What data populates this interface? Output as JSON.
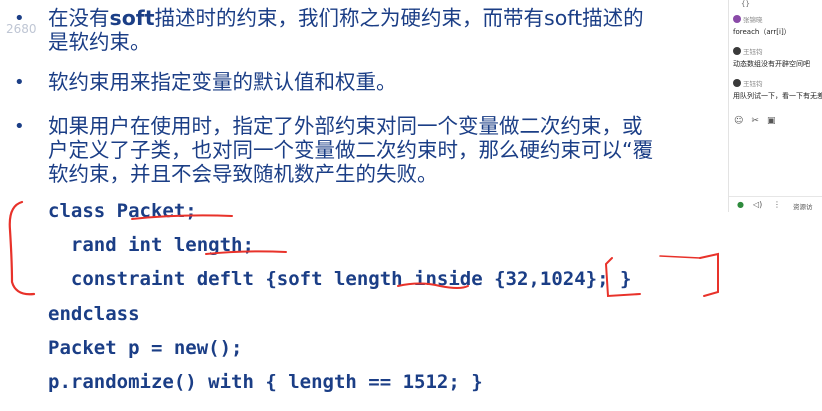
{
  "watermark": "2680",
  "bullets": [
    {
      "part1": "在没有",
      "bold": "soft",
      "part2": "描述时的约束，我们称之为硬约束，而带有soft描述的",
      "line2": "是软约束。"
    },
    {
      "line1": "软约束用来指定变量的默认值和权重。"
    },
    {
      "line1": "如果用户在使用时，指定了外部约束对同一个变量做二次约束，或",
      "line2": "户定义了子类，也对同一个变量做二次约束时，那么硬约束可以“覆",
      "line3": "软约束，并且不会导致随机数产生的失败。"
    }
  ],
  "code": [
    "class Packet;",
    "  rand int length;",
    "  constraint deflt {soft length inside {32,1024}; }",
    "endclass",
    "Packet p = new();",
    "p.randomize() with { length == 1512; }"
  ],
  "chat": {
    "top_char": "{}",
    "messages": [
      {
        "name": "张锦晓",
        "body": "foreach（arr[i]）",
        "avatar_color": "#8a4aa8"
      },
      {
        "name": "王钰钧",
        "body": "动态数组没有开辟空间吧",
        "avatar_color": "#3a3a3a"
      },
      {
        "name": "王钰钧",
        "body": "用队列试一下，看一下有无差",
        "avatar_color": "#3a3a3a"
      }
    ],
    "tools": [
      "smile-icon",
      "scissors-icon",
      "image-icon"
    ],
    "bottom": {
      "mic": "mic-icon",
      "speaker": "speaker-icon",
      "label": "资源访"
    }
  },
  "colors": {
    "text": "#1b3e86",
    "annotation": "#e8322a"
  }
}
